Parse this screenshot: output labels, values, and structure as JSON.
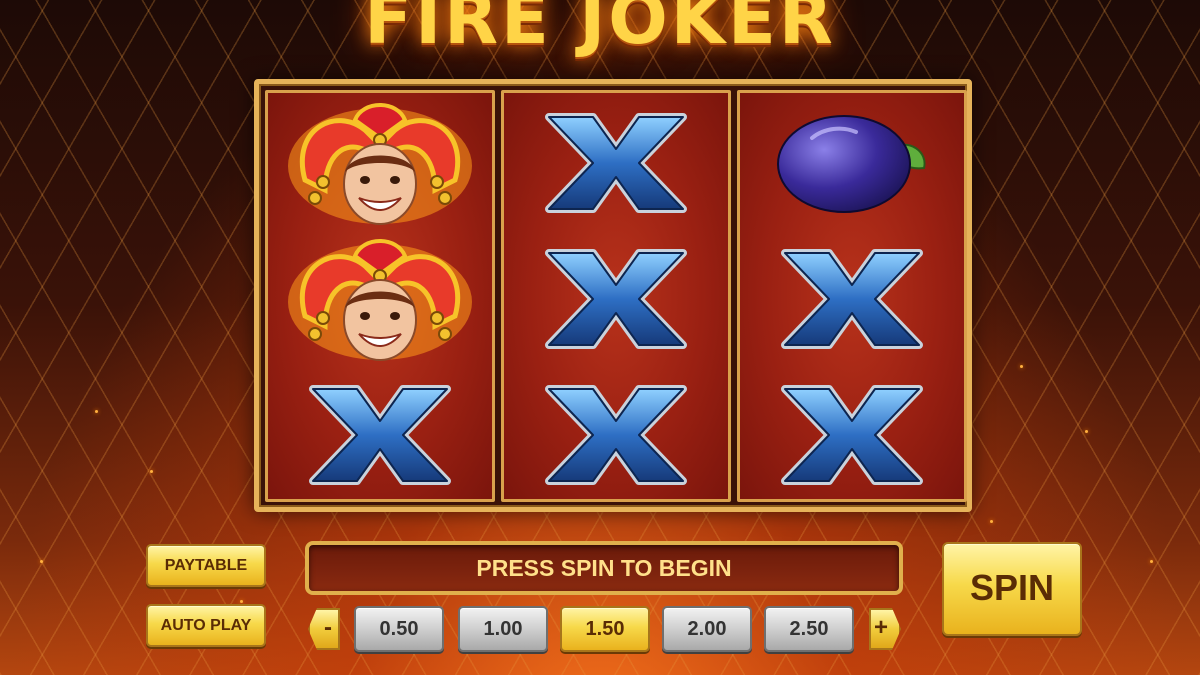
{
  "game": {
    "title": "FIRE JOKER"
  },
  "reels": [
    {
      "symbols": [
        "joker",
        "joker",
        "x"
      ]
    },
    {
      "symbols": [
        "x",
        "x",
        "x"
      ]
    },
    {
      "symbols": [
        "plum",
        "x",
        "x"
      ]
    }
  ],
  "controls": {
    "paytable_label": "PAYTABLE",
    "autoplay_label": "AUTO PLAY",
    "status_message": "PRESS SPIN TO BEGIN",
    "spin_label": "SPIN",
    "decrease_label": "-",
    "increase_label": "+",
    "bets": [
      "0.50",
      "1.00",
      "1.50",
      "2.00",
      "2.50"
    ],
    "selected_bet": "1.50"
  },
  "colors": {
    "gold": "#e6b35a",
    "reel_red": "#9a2012",
    "x_blue": "#2e6fc4",
    "title_yellow": "#ffd447"
  },
  "icons": {
    "joker": "joker-symbol-icon",
    "x": "x-symbol-icon",
    "plum": "plum-symbol-icon"
  }
}
